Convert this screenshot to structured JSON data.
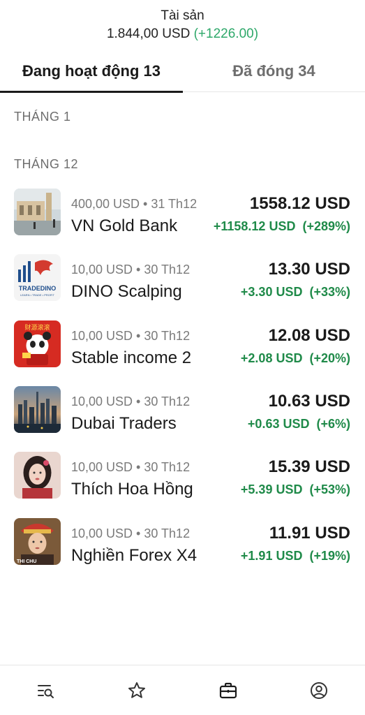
{
  "header": {
    "title": "Tài sản",
    "value": "1.844,00 USD",
    "change": "(+1226.00)"
  },
  "tabs": [
    {
      "label": "Đang hoạt động 13",
      "active": true
    },
    {
      "label": "Đã đóng 34",
      "active": false
    }
  ],
  "sections": {
    "month1": "THÁNG 1",
    "month12": "THÁNG 12"
  },
  "colors": {
    "positive": "#1f8a49",
    "header_positive": "#2ea86a"
  },
  "strategies": [
    {
      "meta": "400,00 USD • 31 Th12",
      "name": "VN Gold Bank",
      "value": "1558.12 USD",
      "change": "+1158.12 USD",
      "pct": "(+289%)",
      "icon": "mosque-photo-avatar"
    },
    {
      "meta": "10,00 USD • 30 Th12",
      "name": "DINO Scalping",
      "value": "13.30 USD",
      "change": "+3.30 USD",
      "pct": "(+33%)",
      "icon": "tradedino-logo-avatar",
      "logo_text": "TRADEDINO",
      "logo_sub": "LEARN • TRADE • PROFIT"
    },
    {
      "meta": "10,00 USD • 30 Th12",
      "name": "Stable income 2",
      "value": "12.08 USD",
      "change": "+2.08 USD",
      "pct": "(+20%)",
      "icon": "panda-avatar",
      "logo_text": "财源滚滚"
    },
    {
      "meta": "10,00 USD • 30 Th12",
      "name": "Dubai Traders",
      "value": "10.63 USD",
      "change": "+0.63 USD",
      "pct": "(+6%)",
      "icon": "dubai-skyline-avatar"
    },
    {
      "meta": "10,00 USD • 30 Th12",
      "name": "Thích Hoa Hồng",
      "value": "15.39 USD",
      "change": "+5.39 USD",
      "pct": "(+53%)",
      "icon": "woman-portrait-avatar"
    },
    {
      "meta": "10,00 USD • 30 Th12",
      "name": "Nghiền Forex X4",
      "value": "11.91 USD",
      "change": "+1.91 USD",
      "pct": "(+19%)",
      "icon": "monk-portrait-avatar",
      "logo_text": "THI CHU"
    }
  ],
  "bottom_nav": [
    {
      "icon": "search-list-icon"
    },
    {
      "icon": "star-icon"
    },
    {
      "icon": "briefcase-icon",
      "active": true
    },
    {
      "icon": "profile-icon"
    }
  ]
}
